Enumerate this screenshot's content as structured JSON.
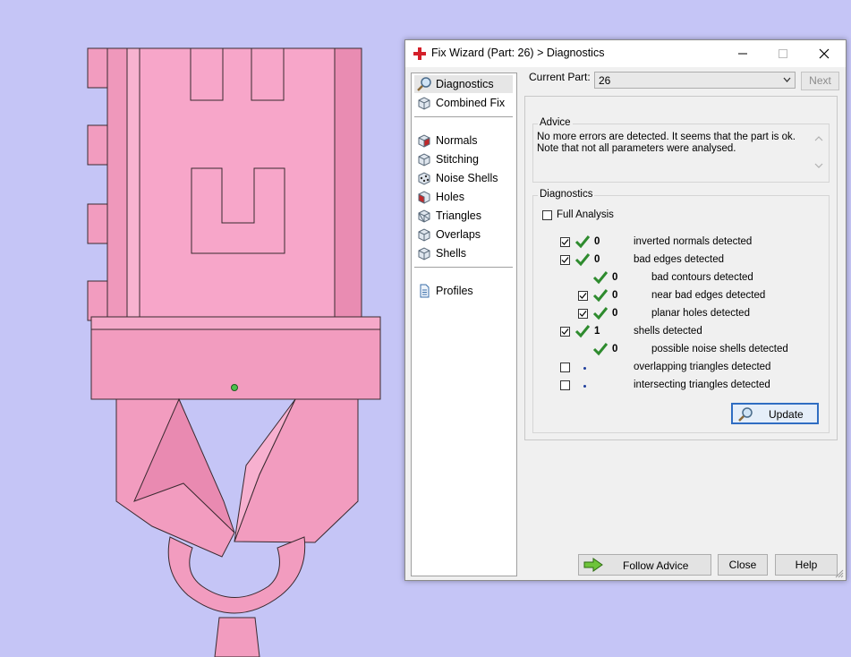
{
  "window": {
    "title": "Fix Wizard (Part: 26) > Diagnostics"
  },
  "nav": {
    "items": [
      {
        "label": "Diagnostics",
        "icon": "magnifier-icon"
      },
      {
        "label": "Combined Fix",
        "icon": "cube-icon"
      },
      {
        "label": "Normals",
        "icon": "normals-cube-icon"
      },
      {
        "label": "Stitching",
        "icon": "stitching-cube-icon"
      },
      {
        "label": "Noise Shells",
        "icon": "noise-shells-icon"
      },
      {
        "label": "Holes",
        "icon": "holes-cube-icon"
      },
      {
        "label": "Triangles",
        "icon": "triangles-cube-icon"
      },
      {
        "label": "Overlaps",
        "icon": "overlaps-cube-icon"
      },
      {
        "label": "Shells",
        "icon": "shells-cube-icon"
      },
      {
        "label": "Profiles",
        "icon": "document-icon"
      }
    ]
  },
  "current_part": {
    "label": "Current Part:",
    "value": "26",
    "next_label": "Next"
  },
  "advice": {
    "title": "Advice",
    "line1": "No more errors are detected. It seems that the part is ok.",
    "line2": "Note that not all parameters were analysed."
  },
  "diagnostics": {
    "title": "Diagnostics",
    "full_analysis": "Full Analysis",
    "rows": [
      {
        "count": "0",
        "text": "inverted normals detected"
      },
      {
        "count": "0",
        "text": "bad edges detected"
      },
      {
        "count": "0",
        "text": "bad contours detected"
      },
      {
        "count": "0",
        "text": "near bad edges detected"
      },
      {
        "count": "0",
        "text": "planar holes detected"
      },
      {
        "count": "1",
        "text": "shells detected"
      },
      {
        "count": "0",
        "text": "possible noise shells detected"
      },
      {
        "count": "",
        "text": "overlapping triangles detected"
      },
      {
        "count": "",
        "text": "intersecting triangles detected"
      }
    ],
    "update_label": "Update"
  },
  "footer": {
    "follow_advice": "Follow Advice",
    "close": "Close",
    "help": "Help"
  },
  "colors": {
    "model": "#f6a2c6",
    "viewport": "#c5c5f6",
    "check": "#2e8b2e"
  }
}
